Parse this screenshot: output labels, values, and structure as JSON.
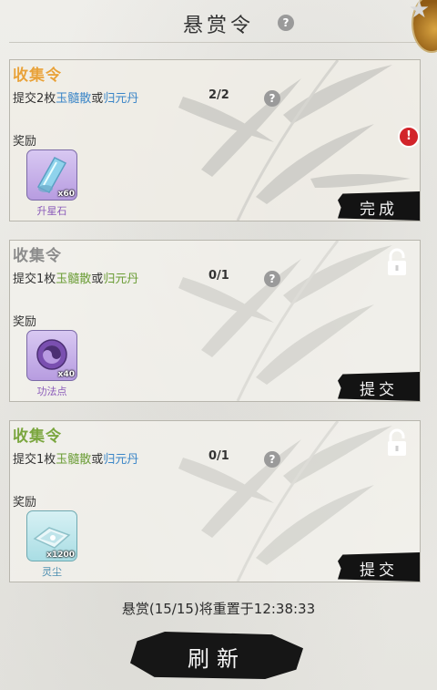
{
  "header": {
    "title": "悬赏令"
  },
  "tasks": [
    {
      "title": "收集令",
      "prefix": "提交2枚",
      "item_a": "玉髓散",
      "conj": "或",
      "item_b": "归元丹",
      "progress": "2/2",
      "reward_label": "奖励",
      "reward": {
        "name": "升星石",
        "qty": "x60",
        "icon": "star-stone-icon"
      },
      "button": "完成",
      "locked": false,
      "title_color": "#e8a23a"
    },
    {
      "title": "收集令",
      "prefix": "提交1枚",
      "item_a": "玉髓散",
      "conj": "或",
      "item_b": "归元丹",
      "progress": "0/1",
      "reward_label": "奖励",
      "reward": {
        "name": "功法点",
        "qty": "x40",
        "icon": "skill-point-icon"
      },
      "button": "提交",
      "locked": true,
      "title_color": "#8c8c8c"
    },
    {
      "title": "收集令",
      "prefix": "提交1枚",
      "item_a": "玉髓散",
      "conj": "或",
      "item_b": "归元丹",
      "progress": "0/1",
      "reward_label": "奖励",
      "reward": {
        "name": "灵尘",
        "qty": "x1200",
        "icon": "spirit-dust-icon"
      },
      "button": "提交",
      "locked": true,
      "title_color": "#7aa63e"
    }
  ],
  "footer": {
    "reset_text": "悬赏(15/15)将重置于12:38:33",
    "refresh_button": "刷新"
  },
  "icons": {
    "help": "?",
    "alert": "!"
  }
}
